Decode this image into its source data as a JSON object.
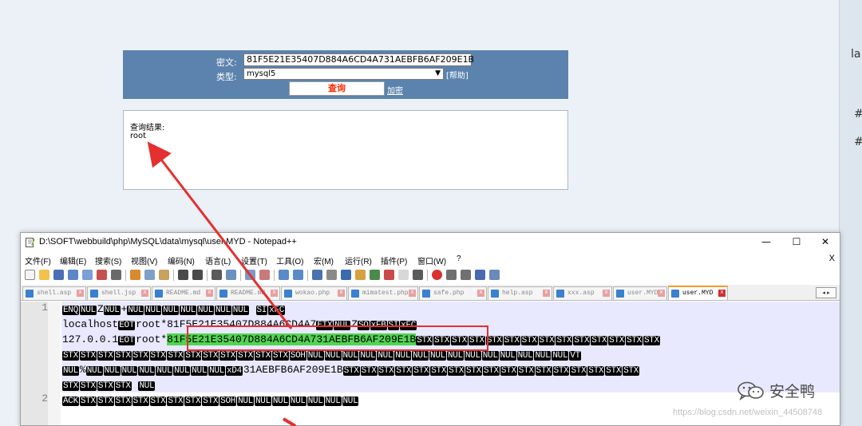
{
  "web_form": {
    "cipher_label": "密文:",
    "cipher_value": "81F5E21E35407D884A6CD4A731AEBFB6AF209E1B",
    "type_label": "类型:",
    "type_value": "mysql5",
    "help_link": "[帮助]",
    "query_button": "查询",
    "encrypt_link": "加密"
  },
  "result": {
    "label": "查询结果:",
    "value": "root"
  },
  "edge_glyphs": [
    "la",
    "#",
    "#"
  ],
  "npp": {
    "title": "D:\\SOFT\\webbuild\\php\\MySQL\\data\\mysql\\user.MYD - Notepad++",
    "window_buttons": {
      "minimize": "—",
      "maximize": "☐",
      "close": "✕"
    },
    "menu": [
      "文件(F)",
      "编辑(E)",
      "搜索(S)",
      "视图(V)",
      "编码(N)",
      "语言(L)",
      "设置(T)",
      "工具(O)",
      "宏(M)",
      "运行(R)",
      "插件(P)",
      "窗口(W)",
      "?"
    ],
    "menu_close": "X",
    "tabs": [
      "shell.asp",
      "shell.jsp",
      "README.md",
      "README.md",
      "wokao.php",
      "mimatest.php",
      "safe.php",
      "help.asp",
      "xxx.asp",
      "user.MYD",
      "user.MYD"
    ],
    "active_tab_index": 10,
    "tab_scroll": "◂ ▸",
    "line_numbers": [
      "1",
      "2"
    ],
    "lines": {
      "l1": [
        [
          "c",
          "ENQ"
        ],
        [
          "c",
          "NUL"
        ],
        [
          "t",
          "Z"
        ],
        [
          "c",
          "NUL"
        ],
        [
          "t",
          "+"
        ],
        [
          "c",
          "NUL"
        ],
        [
          "c",
          "NUL"
        ],
        [
          "c",
          "NUL"
        ],
        [
          "c",
          "NUL"
        ],
        [
          "c",
          "NUL"
        ],
        [
          "c",
          "NUL"
        ],
        [
          "c",
          "NUL"
        ],
        [
          "t",
          "   "
        ],
        [
          "c",
          "SI"
        ],
        [
          "c",
          "xFC"
        ]
      ],
      "l2": [
        [
          "t",
          "localhost"
        ],
        [
          "c",
          "EOT"
        ],
        [
          "t",
          "root*81F5E21E35407D884A6CD4A7"
        ],
        [
          "c",
          "ETX"
        ],
        [
          "c",
          "NUL"
        ],
        [
          "t",
          "Z"
        ],
        [
          "c",
          "SO"
        ],
        [
          "c",
          "xFB"
        ],
        [
          "c",
          "SI"
        ],
        [
          "c",
          "xFC"
        ]
      ],
      "l3": [
        [
          "t",
          "127.0.0.1"
        ],
        [
          "c",
          "EOT"
        ],
        [
          "t",
          "root*"
        ],
        [
          "h",
          "81F5E21E35407D884A6CD4A731AEBFB6AF209E1B"
        ],
        [
          "c",
          "STX"
        ],
        [
          "c",
          "STX"
        ],
        [
          "c",
          "STX"
        ],
        [
          "c",
          "STX"
        ],
        [
          "c",
          "STX"
        ],
        [
          "c",
          "STX"
        ],
        [
          "c",
          "STX"
        ],
        [
          "c",
          "STX"
        ],
        [
          "c",
          "STX"
        ],
        [
          "c",
          "STX"
        ],
        [
          "c",
          "STX"
        ],
        [
          "c",
          "STX"
        ],
        [
          "c",
          "STX"
        ],
        [
          "c",
          "STX"
        ]
      ],
      "l4": [
        [
          "c",
          "STX"
        ],
        [
          "c",
          "STX"
        ],
        [
          "c",
          "STX"
        ],
        [
          "c",
          "STX"
        ],
        [
          "c",
          "STX"
        ],
        [
          "c",
          "STX"
        ],
        [
          "c",
          "STX"
        ],
        [
          "c",
          "STX"
        ],
        [
          "c",
          "STX"
        ],
        [
          "c",
          "STX"
        ],
        [
          "c",
          "STX"
        ],
        [
          "c",
          "STX"
        ],
        [
          "c",
          "STX"
        ],
        [
          "c",
          "SOH"
        ],
        [
          "c",
          "NUL"
        ],
        [
          "c",
          "NUL"
        ],
        [
          "c",
          "NUL"
        ],
        [
          "c",
          "NUL"
        ],
        [
          "c",
          "NUL"
        ],
        [
          "c",
          "NUL"
        ],
        [
          "c",
          "NUL"
        ],
        [
          "c",
          "NUL"
        ],
        [
          "c",
          "NUL"
        ],
        [
          "c",
          "NUL"
        ],
        [
          "c",
          "NUL"
        ],
        [
          "c",
          "NUL"
        ],
        [
          "c",
          "NUL"
        ],
        [
          "c",
          "NUL"
        ],
        [
          "c",
          "NUL"
        ],
        [
          "c",
          "VT"
        ]
      ],
      "l5": [
        [
          "c",
          "NUL"
        ],
        [
          "t",
          "%"
        ],
        [
          "c",
          "NUL"
        ],
        [
          "c",
          "NUL"
        ],
        [
          "c",
          "NUL"
        ],
        [
          "c",
          "NUL"
        ],
        [
          "c",
          "NUL"
        ],
        [
          "c",
          "NUL"
        ],
        [
          "c",
          "NUL"
        ],
        [
          "c",
          "NUL"
        ],
        [
          "c",
          "xD4"
        ],
        [
          "t",
          "31AEBFB6AF209E1B"
        ],
        [
          "c",
          "STX"
        ],
        [
          "c",
          "STX"
        ],
        [
          "c",
          "STX"
        ],
        [
          "c",
          "STX"
        ],
        [
          "c",
          "STX"
        ],
        [
          "c",
          "STX"
        ],
        [
          "c",
          "STX"
        ],
        [
          "c",
          "STX"
        ],
        [
          "c",
          "STX"
        ],
        [
          "c",
          "STX"
        ],
        [
          "c",
          "STX"
        ],
        [
          "c",
          "STX"
        ],
        [
          "c",
          "STX"
        ],
        [
          "c",
          "STX"
        ],
        [
          "c",
          "STX"
        ],
        [
          "c",
          "STX"
        ],
        [
          "c",
          "STX"
        ]
      ],
      "l6": [
        [
          "c",
          "STX"
        ],
        [
          "c",
          "STX"
        ],
        [
          "c",
          "STX"
        ],
        [
          "c",
          "STX"
        ],
        [
          "t",
          "  "
        ],
        [
          "c",
          "NUL"
        ]
      ],
      "l7": [
        [
          "c",
          "ACK"
        ],
        [
          "c",
          "STX"
        ],
        [
          "c",
          "STX"
        ],
        [
          "c",
          "STX"
        ],
        [
          "c",
          "STX"
        ],
        [
          "c",
          "STX"
        ],
        [
          "c",
          "STX"
        ],
        [
          "c",
          "STX"
        ],
        [
          "c",
          "STX"
        ],
        [
          "c",
          "SOH"
        ],
        [
          "c",
          "NUL"
        ],
        [
          "c",
          "NUL"
        ],
        [
          "c",
          "NUL"
        ],
        [
          "c",
          "NUL"
        ],
        [
          "c",
          "NUL"
        ],
        [
          "c",
          "NUL"
        ],
        [
          "c",
          "NUL"
        ]
      ]
    }
  },
  "watermark": {
    "brand": "安全鸭",
    "csdn": "https://blog.csdn.net/weixin_44508748"
  },
  "colors": {
    "form_bg": "#5b83ad",
    "query_button_text": "#ff2a00",
    "highlight_green": "#52d452",
    "annotation_red": "#e53030"
  }
}
